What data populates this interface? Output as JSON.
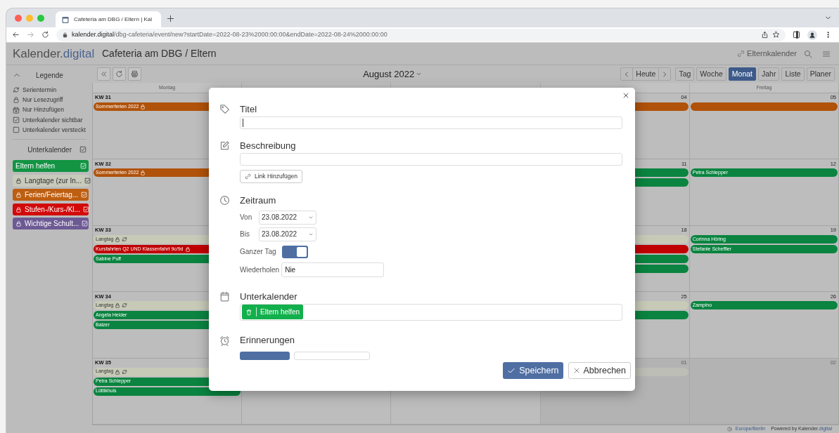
{
  "browser": {
    "tab_title": "Cafeteria am DBG / Eltern | Kal",
    "url_domain": "kalender.digital",
    "url_path": "/dbg-cafeteria/event/new?startDate=2022-08-23%2000:00:00&endDate=2022-08-24%2000:00:00"
  },
  "app": {
    "logo_main": "Kalender.",
    "logo_accent": "digital",
    "title": "Cafeteria am DBG / Eltern",
    "calendar_link": "Elternkalender"
  },
  "legend": {
    "title": "Legende",
    "items": [
      {
        "kind": "repeat",
        "label": "Serientermin"
      },
      {
        "kind": "lock",
        "label": "Nur Lesezugriff"
      },
      {
        "kind": "add",
        "label": "Nur Hinzufügen"
      },
      {
        "kind": "checked",
        "label": "Unterkalender sichtbar"
      },
      {
        "kind": "unchecked",
        "label": "Unterkalender versteckt"
      }
    ]
  },
  "subcalendars": {
    "title": "Unterkalender",
    "all_checked": true,
    "items": [
      {
        "label": "Eltern helfen",
        "color": "#129443",
        "locked": false,
        "checked": true
      },
      {
        "label": "Langtage (zur In...",
        "color": "#c8cabb",
        "locked": true,
        "checked": true
      },
      {
        "label": "Ferien/Feiertag...",
        "color": "#bd5e10",
        "locked": true,
        "checked": true
      },
      {
        "label": "Stufen-/Kurs-/Kl...",
        "color": "#d20a0a",
        "locked": true,
        "checked": true
      },
      {
        "label": "Wichtige Schult...",
        "color": "#6d5a94",
        "locked": true,
        "checked": true
      }
    ]
  },
  "toolbar": {
    "month": "August 2022",
    "today": "Heute",
    "views": [
      {
        "label": "Tag",
        "selected": false
      },
      {
        "label": "Woche",
        "selected": false
      },
      {
        "label": "Monat",
        "selected": true
      },
      {
        "label": "Jahr",
        "selected": false
      },
      {
        "label": "Liste",
        "selected": false
      },
      {
        "label": "Planer",
        "selected": false
      }
    ]
  },
  "calendar": {
    "day_headers": {
      "monday": "Montag",
      "friday": "Freitag"
    },
    "weeks": [
      {
        "label": "KW 31",
        "days": {
          "monday": {
            "events": [
              {
                "label": "Sommerferien 2022",
                "color": "#b0520a",
                "locked": true,
                "repeating": false
              }
            ]
          },
          "thursday": {
            "number": "04",
            "other_month": false,
            "events": [
              {
                "color": "#b0520a"
              }
            ]
          },
          "friday": {
            "number": "05",
            "other_month": false,
            "events": [
              {
                "color": "#b0520a"
              }
            ]
          }
        }
      },
      {
        "label": "KW 32",
        "days": {
          "monday": {
            "events": [
              {
                "label": "Sommerferien 2022",
                "color": "#b0520a",
                "locked": true,
                "repeating": false
              }
            ]
          },
          "thursday": {
            "number": "11",
            "other_month": false,
            "events": [
              {
                "color": "#0a8440"
              },
              {
                "color": "#0a8440"
              }
            ]
          },
          "friday": {
            "number": "12",
            "other_month": false,
            "events": [
              {
                "label": "Petra Schlepper",
                "color": "#0a8440",
                "locked": false,
                "repeating": false
              }
            ]
          }
        }
      },
      {
        "label": "KW 33",
        "days": {
          "monday": {
            "events": [
              {
                "label": "Langtag",
                "color": "#c8cab8",
                "locked": true,
                "repeating": true
              },
              {
                "label": "Kursfahrten Q2 UND Klassenfahrt 9c/9d",
                "color": "#c00000",
                "locked": true,
                "repeating": false
              },
              {
                "label": "Sabine Puff",
                "color": "#0a8440",
                "locked": false,
                "repeating": false
              }
            ]
          },
          "thursday": {
            "number": "18",
            "other_month": false,
            "events": [
              {
                "color": "#c8cab8"
              },
              {
                "color": "#c00000"
              },
              {
                "color": "#0a8440"
              },
              {
                "color": "#0a8440"
              }
            ]
          },
          "friday": {
            "number": "19",
            "other_month": false,
            "events": [
              {
                "label": "Corinna Höring",
                "color": "#0a8440",
                "locked": false,
                "repeating": false
              },
              {
                "label": "Stefanie Scheffler",
                "color": "#0a8440",
                "locked": false,
                "repeating": false
              }
            ]
          }
        }
      },
      {
        "label": "KW 34",
        "days": {
          "monday": {
            "events": [
              {
                "label": "Langtag",
                "color": "#c8cab8",
                "locked": true,
                "repeating": true
              },
              {
                "label": "Angela Heider",
                "color": "#0a8440",
                "locked": false,
                "repeating": false
              },
              {
                "label": "Balzer",
                "color": "#0a8440",
                "locked": false,
                "repeating": false
              }
            ]
          },
          "thursday": {
            "number": "25",
            "other_month": false,
            "events": [
              {
                "color": "#c8cab8"
              },
              {
                "color": "#0a8440"
              }
            ]
          },
          "friday": {
            "number": "26",
            "other_month": false,
            "events": [
              {
                "label": "Zampino",
                "color": "#0a8440",
                "locked": false,
                "repeating": false
              }
            ]
          }
        }
      },
      {
        "label": "KW 35",
        "days": {
          "monday": {
            "events": [
              {
                "label": "Langtag",
                "color": "#c8cab8",
                "locked": true,
                "repeating": true
              },
              {
                "label": "Petra Schlepper",
                "color": "#0a8440",
                "locked": false,
                "repeating": false
              },
              {
                "label": "Lüttikhuis",
                "color": "#0a8440",
                "locked": false,
                "repeating": false
              }
            ]
          },
          "thursday": {
            "number": "01",
            "other_month": true,
            "events": [
              {
                "color": "#c8cab8"
              }
            ]
          },
          "friday": {
            "number": "02",
            "other_month": true
          }
        }
      }
    ]
  },
  "dialog": {
    "title": {
      "label": "Titel"
    },
    "description": {
      "label": "Beschreibung",
      "link_button": "Link Hinzufügen"
    },
    "period": {
      "label": "Zeitraum",
      "from_label": "Von",
      "from": "23.08.2022",
      "to_label": "Bis",
      "to": "23.08.2022",
      "all_day_label": "Ganzer Tag",
      "all_day": true,
      "repeat_label": "Wiederholen",
      "repeat": "Nie"
    },
    "subcalendar": {
      "label": "Unterkalender",
      "selected": "Eltern helfen",
      "color": "#12b04c"
    },
    "reminders": {
      "label": "Erinnerungen"
    },
    "save": "Speichern",
    "cancel": "Abbrechen"
  },
  "footer": {
    "timezone": "Europe/Berlin",
    "powered_prefix": "Powered by",
    "brand_main": "Kalender.",
    "brand_accent": "digital"
  }
}
